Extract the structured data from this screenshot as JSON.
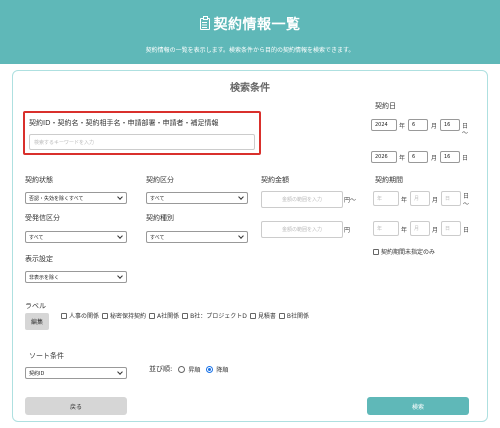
{
  "header": {
    "title": "契約情報一覧",
    "subtitle": "契約情報の一覧を表示します。検索条件から目的の契約情報を検索できます。"
  },
  "panel": {
    "title": "検索条件"
  },
  "keyword": {
    "label": "契約ID・契約名・契約相手名・申請部署・申請者・補足情報",
    "placeholder": "検索するキーワードを入力"
  },
  "contract_date": {
    "label": "契約日",
    "from": {
      "year": "2024",
      "month": "6",
      "day": "16"
    },
    "to": {
      "year": "2026",
      "month": "6",
      "day": "16"
    },
    "unit_year": "年",
    "unit_month": "月",
    "unit_day": "日",
    "tilde": "〜"
  },
  "contract_status": {
    "label": "契約状態",
    "value": "否認・失効を除くすべて"
  },
  "contract_category": {
    "label": "契約区分",
    "value": "すべて"
  },
  "contract_amount": {
    "label": "契約金額",
    "placeholder": "金額の範囲を入力",
    "unit_from": "円〜",
    "unit_to": "円"
  },
  "contract_period": {
    "label": "契約期間",
    "placeholder_year": "年",
    "placeholder_month": "月",
    "placeholder_day": "日",
    "unit_year": "年",
    "unit_month": "月",
    "unit_day": "日",
    "tilde": "〜",
    "unset_label": "契約期間未指定のみ"
  },
  "send_receive": {
    "label": "受発信区分",
    "value": "すべて"
  },
  "contract_type": {
    "label": "契約種別",
    "value": "すべて"
  },
  "display": {
    "label": "表示設定",
    "value": "非表示を除く"
  },
  "labels": {
    "label": "ラベル",
    "edit_button": "編集",
    "items": [
      "人事の関係",
      "秘密保持契約",
      "A社関係",
      "B社：プロジェクトD",
      "見積書",
      "B社関係"
    ]
  },
  "sort": {
    "label": "ソート条件",
    "value": "契約ID",
    "order_label": "並び順:",
    "asc": "昇順",
    "desc": "降順",
    "selected": "降順"
  },
  "buttons": {
    "back": "戻る",
    "search": "検索"
  }
}
